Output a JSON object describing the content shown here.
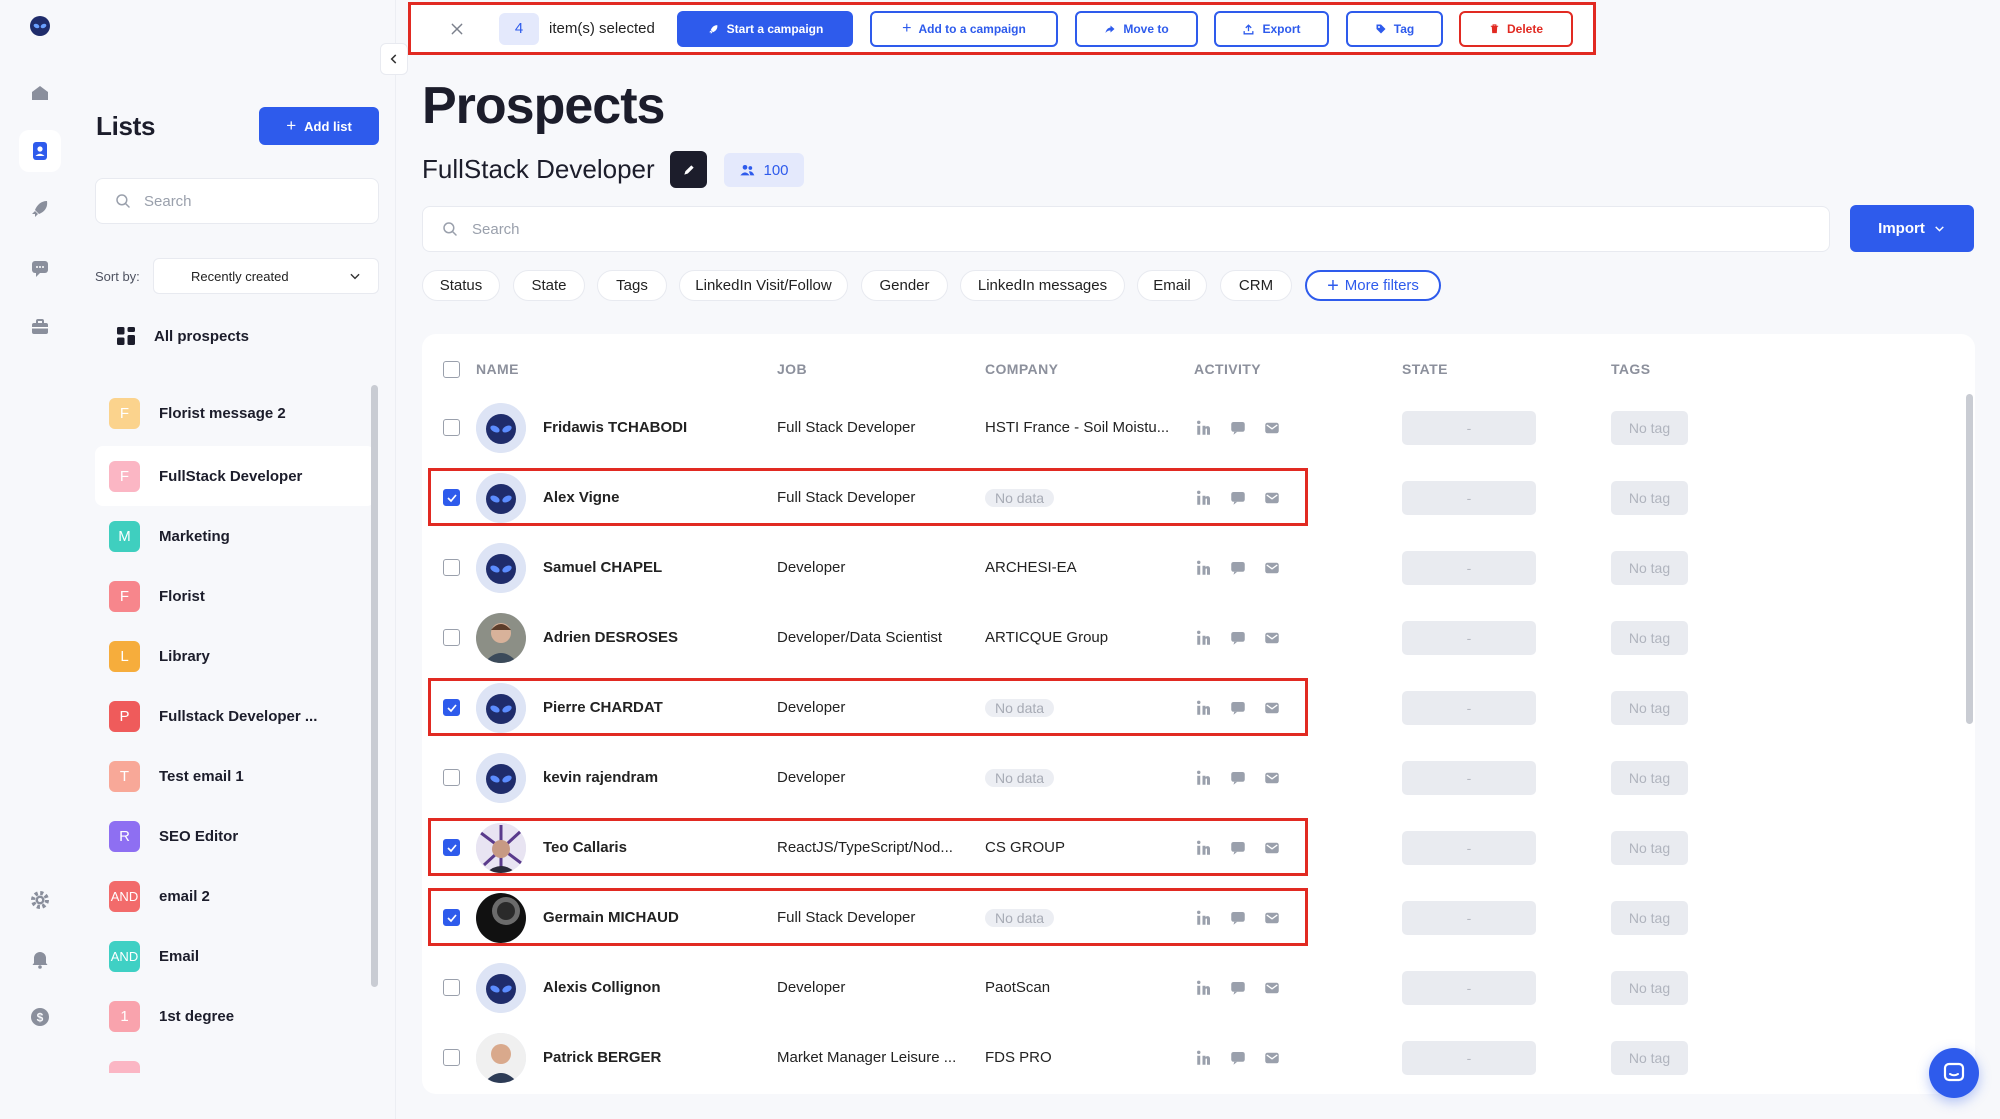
{
  "rail": {
    "items": [
      {
        "icon": "alien-logo-icon"
      },
      {
        "icon": "home-icon"
      },
      {
        "icon": "contacts-icon"
      },
      {
        "icon": "rocket-icon"
      },
      {
        "icon": "chat-icon"
      },
      {
        "icon": "briefcase-icon"
      },
      {
        "icon": "gear-icon"
      },
      {
        "icon": "bell-icon"
      },
      {
        "icon": "dollar-icon"
      }
    ]
  },
  "lists_panel": {
    "title": "Lists",
    "add_list_label": "Add list",
    "search_placeholder": "Search",
    "sort_label": "Sort by:",
    "sort_value": "Recently created",
    "all_prospects_label": "All prospects",
    "items": [
      {
        "badge": "F",
        "color": "#fbd38d",
        "label": "Florist message 2"
      },
      {
        "badge": "F",
        "color": "#fbb6c4",
        "label": "FullStack Developer"
      },
      {
        "badge": "M",
        "color": "#3fcfbf",
        "label": "Marketing"
      },
      {
        "badge": "F",
        "color": "#f7868c",
        "label": "Florist"
      },
      {
        "badge": "L",
        "color": "#f6ad3c",
        "label": "Library"
      },
      {
        "badge": "P",
        "color": "#ef5b5b",
        "label": "Fullstack Developer ..."
      },
      {
        "badge": "T",
        "color": "#f8a898",
        "label": "Test email 1"
      },
      {
        "badge": "R",
        "color": "#8e6ff2",
        "label": "SEO Editor"
      },
      {
        "badge": "AND",
        "color": "#f26b6b",
        "label": "email 2"
      },
      {
        "badge": "AND",
        "color": "#3fd0c4",
        "label": "Email"
      },
      {
        "badge": "1",
        "color": "#f9a3ad",
        "label": "1st degree"
      },
      {
        "badge": "",
        "color": "#fbb6c4",
        "label": ""
      }
    ]
  },
  "bulk_bar": {
    "count": "4",
    "selected_text": "item(s) selected",
    "start_campaign": "Start a campaign",
    "add_to_campaign": "Add to a campaign",
    "move_to": "Move to",
    "export": "Export",
    "tag": "Tag",
    "delete": "Delete",
    "highlight_color": "#e12a22"
  },
  "main": {
    "title": "Prospects",
    "list_name": "FullStack Developer",
    "prospect_count": "100",
    "search_placeholder": "Search",
    "import_label": "Import",
    "filters": [
      "Status",
      "State",
      "Tags",
      "LinkedIn Visit/Follow",
      "Gender",
      "LinkedIn messages",
      "Email",
      "CRM"
    ],
    "more_filters_label": "More filters",
    "columns": {
      "name": "NAME",
      "job": "JOB",
      "company": "COMPANY",
      "activity": "ACTIVITY",
      "state": "STATE",
      "tags": "TAGS"
    },
    "no_data_label": "No data",
    "state_placeholder": "-",
    "no_tag_label": "No tag",
    "rows": [
      {
        "name": "Fridawis TCHABODI",
        "job": "Full Stack Developer",
        "company": "HSTI France - Soil Moistu...",
        "checked": false,
        "avatar": "alien"
      },
      {
        "name": "Alex Vigne",
        "job": "Full Stack Developer",
        "company": "",
        "checked": true,
        "avatar": "alien"
      },
      {
        "name": "Samuel CHAPEL",
        "job": "Developer",
        "company": "ARCHESI-EA",
        "checked": false,
        "avatar": "alien"
      },
      {
        "name": "Adrien DESROSES",
        "job": "Developer/Data Scientist",
        "company": "ARTICQUE Group",
        "checked": false,
        "avatar": "photo-1"
      },
      {
        "name": "Pierre CHARDAT",
        "job": "Developer",
        "company": "",
        "checked": true,
        "avatar": "alien"
      },
      {
        "name": "kevin rajendram",
        "job": "Developer",
        "company": "",
        "checked": false,
        "avatar": "alien"
      },
      {
        "name": "Teo Callaris",
        "job": "ReactJS/TypeScript/Nod...",
        "company": "CS GROUP",
        "checked": true,
        "avatar": "photo-2"
      },
      {
        "name": "Germain MICHAUD",
        "job": "Full Stack Developer",
        "company": "",
        "checked": true,
        "avatar": "photo-3"
      },
      {
        "name": "Alexis Collignon",
        "job": "Developer",
        "company": "PaotScan",
        "checked": false,
        "avatar": "alien"
      },
      {
        "name": "Patrick BERGER",
        "job": "Market Manager Leisure ...",
        "company": "FDS PRO",
        "checked": false,
        "avatar": "photo-4"
      }
    ]
  },
  "colors": {
    "accent": "#2e5bec",
    "danger": "#e12a22"
  }
}
